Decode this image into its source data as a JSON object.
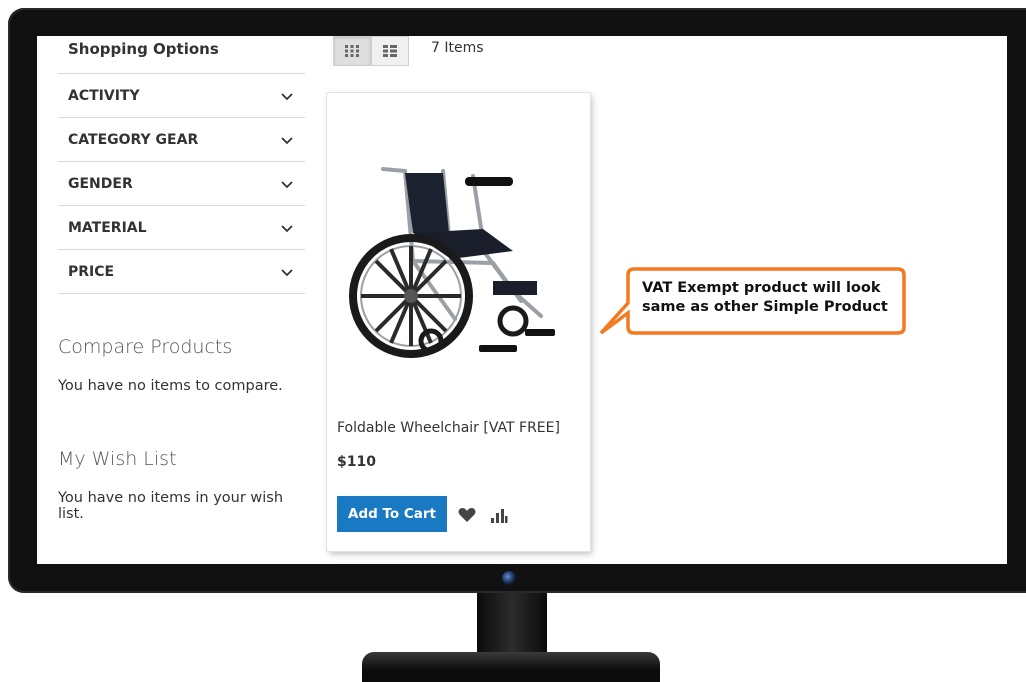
{
  "sidebar": {
    "shopping_options_title": "Shopping Options",
    "filters": [
      "ACTIVITY",
      "CATEGORY GEAR",
      "GENDER",
      "MATERIAL",
      "PRICE"
    ],
    "compare_title": "Compare Products",
    "compare_text": "You have no items to compare.",
    "wishlist_title": "My Wish List",
    "wishlist_text": "You have no items in your wish list."
  },
  "toolbar": {
    "view_modes": [
      "grid-view",
      "list-view"
    ],
    "active_mode": "grid-view",
    "items_count": "7 Items"
  },
  "product": {
    "name": "Foldable Wheelchair [VAT FREE]",
    "price": "$110",
    "add_to_cart_label": "Add To Cart"
  },
  "callout": {
    "line1": "VAT Exempt product will look",
    "line2": "same as other Simple Product",
    "border_color": "#f37a1f"
  },
  "colors": {
    "accent": "#1979c3",
    "text": "#333333"
  },
  "icons": [
    "grid-icon",
    "list-icon",
    "chevron-down-icon",
    "heart-icon",
    "compare-icon",
    "webcam-icon"
  ]
}
